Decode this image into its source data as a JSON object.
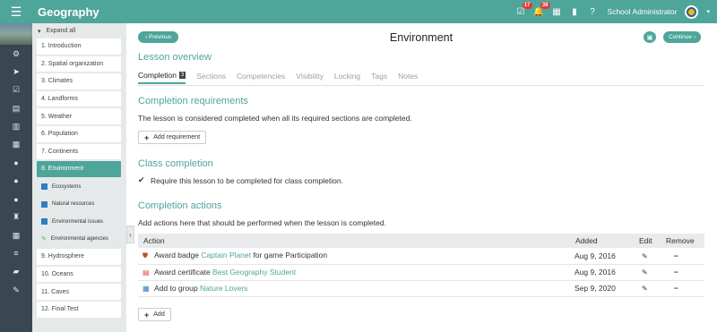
{
  "app": {
    "title": "Geography",
    "notifications_count": "17",
    "messages_count": "38",
    "user_name": "School Administrator",
    "accent": "#4ea59a"
  },
  "lessons": {
    "expand_all": "Expand all",
    "items": [
      {
        "label": "1. Introduction"
      },
      {
        "label": "2. Spatial organization"
      },
      {
        "label": "3. Climates"
      },
      {
        "label": "4. Landforms"
      },
      {
        "label": "5. Weather"
      },
      {
        "label": "6. Population"
      },
      {
        "label": "7. Continents"
      },
      {
        "label": "8. Environment"
      }
    ],
    "sections": [
      {
        "label": "Ecosystems",
        "icon": "document-icon"
      },
      {
        "label": "Natural resources",
        "icon": "document-icon"
      },
      {
        "label": "Environmental issues",
        "icon": "document-icon"
      },
      {
        "label": "Environmental agencies",
        "icon": "leaf-icon"
      }
    ],
    "items_after": [
      {
        "label": "9. Hydrosphere"
      },
      {
        "label": "10. Oceans"
      },
      {
        "label": "11. Caves"
      },
      {
        "label": "12. Final Test"
      }
    ]
  },
  "header": {
    "previous": "Previous",
    "title": "Environment",
    "continue": "Continue"
  },
  "overview": {
    "heading": "Lesson overview",
    "tabs": [
      {
        "label": "Completion",
        "count": "3"
      },
      {
        "label": "Sections"
      },
      {
        "label": "Competencies"
      },
      {
        "label": "Visibility"
      },
      {
        "label": "Locking"
      },
      {
        "label": "Tags"
      },
      {
        "label": "Notes"
      }
    ]
  },
  "requirements": {
    "heading": "Completion requirements",
    "text": "The lesson is considered completed when all its required sections are completed.",
    "add_button": "Add requirement"
  },
  "class_completion": {
    "heading": "Class completion",
    "checkbox_label": "Require this lesson to be completed for class completion."
  },
  "actions": {
    "heading": "Completion actions",
    "text": "Add actions here that should be performed when the lesson is completed.",
    "columns": [
      "Action",
      "Added",
      "Edit",
      "Remove"
    ],
    "rows": [
      {
        "prefix": "Award badge ",
        "link": "Captain Planet",
        "suffix": " for game Participation",
        "added": "Aug 9, 2016"
      },
      {
        "prefix": "Award certificate ",
        "link": "Best Geography Student",
        "suffix": "",
        "added": "Aug 9, 2016"
      },
      {
        "prefix": "Add to group ",
        "link": "Nature Lovers",
        "suffix": "",
        "added": "Sep 9, 2020"
      }
    ],
    "add_button": "Add"
  }
}
